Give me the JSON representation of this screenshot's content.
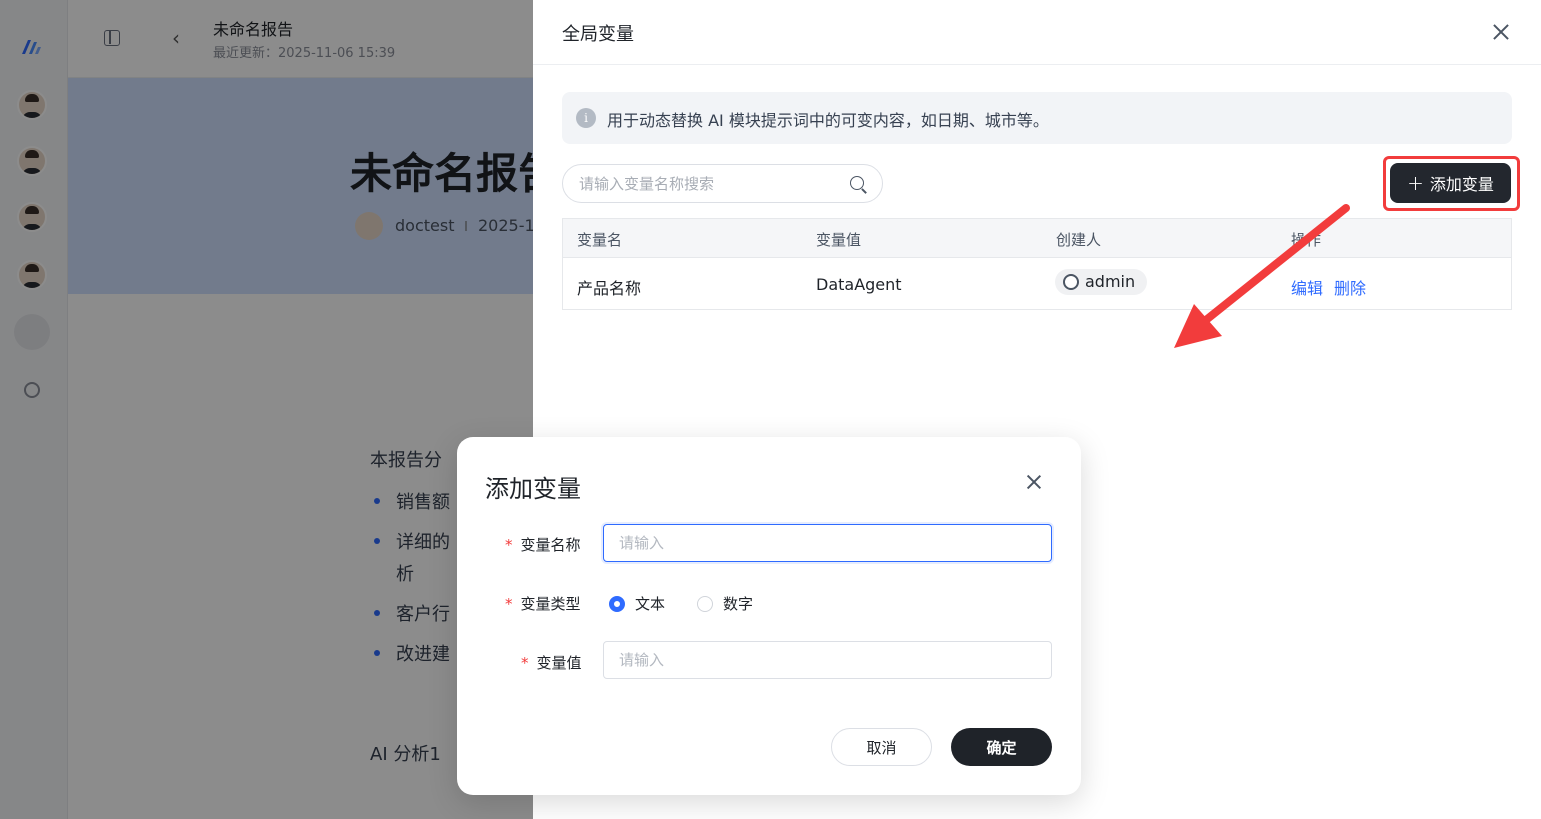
{
  "app": {
    "doc_title": "未命名报告",
    "last_updated": "最近更新：2025-11-06 15:39",
    "hero_title": "未命名报告",
    "author": "doctest",
    "hero_date": "2025-1",
    "content": {
      "intro": "本报告分",
      "bullets": [
        "销售额",
        "详细的",
        "客户行",
        "改进建"
      ],
      "bullet_wrap": "析",
      "section": "AI 分析1"
    }
  },
  "drawer": {
    "title": "全局变量",
    "info_icon_glyph": "i",
    "info_text": "用于动态替换 AI 模块提示词中的可变内容，如日期、城市等。",
    "search_placeholder": "请输入变量名称搜索",
    "add_button_label": "添加变量",
    "add_button_icon": "+",
    "table": {
      "headers": [
        "变量名",
        "变量值",
        "创建人",
        "操作"
      ],
      "rows": [
        {
          "name": "产品名称",
          "value": "DataAgent",
          "creator": "admin",
          "edit": "编辑",
          "delete": "删除"
        }
      ]
    }
  },
  "modal": {
    "title": "添加变量",
    "fields": {
      "name_label": "变量名称",
      "name_placeholder": "请输入",
      "type_label": "变量类型",
      "type_options": [
        "文本",
        "数字"
      ],
      "type_selected": "文本",
      "value_label": "变量值",
      "value_placeholder": "请输入",
      "required_mark": "*"
    },
    "cancel_label": "取消",
    "ok_label": "确定"
  },
  "colors": {
    "accent": "#2f6bff",
    "primary_button": "#23272e",
    "highlight": "#f23c3c",
    "required": "#f23c3c"
  }
}
